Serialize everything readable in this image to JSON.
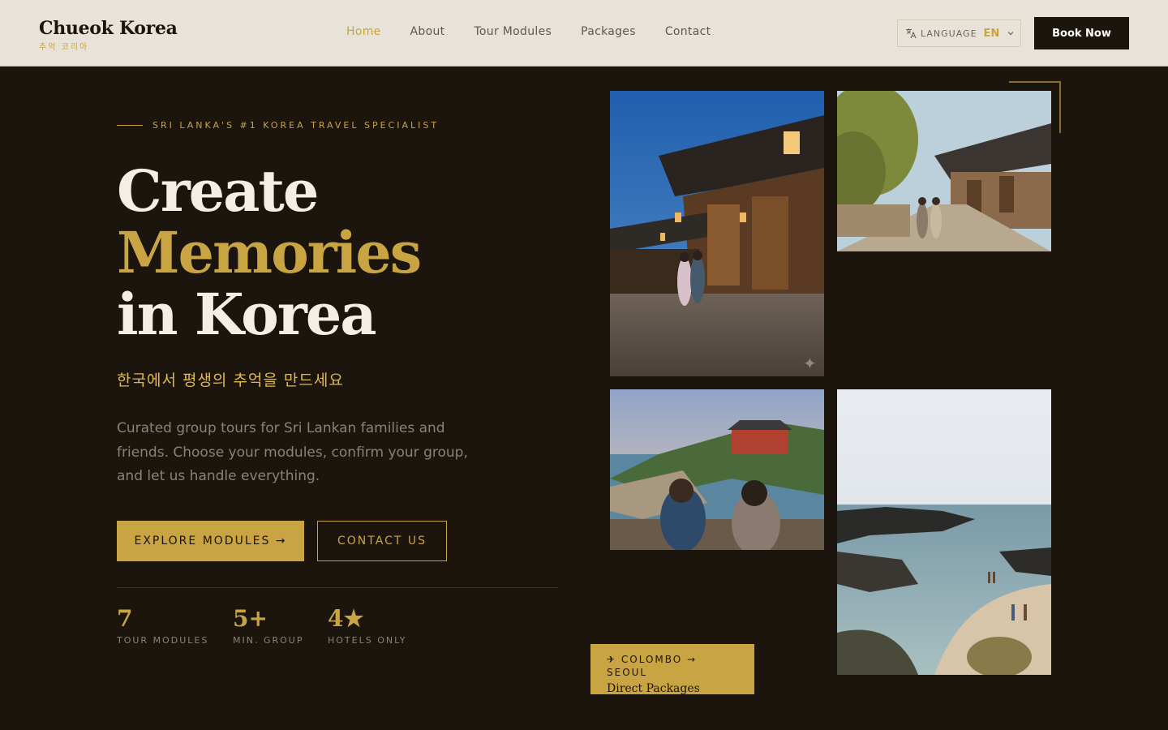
{
  "header": {
    "logo_main": "Chueok Korea",
    "logo_sub": "추억 코리아",
    "nav": [
      {
        "label": "Home",
        "active": true
      },
      {
        "label": "About",
        "active": false
      },
      {
        "label": "Tour Modules",
        "active": false
      },
      {
        "label": "Packages",
        "active": false
      },
      {
        "label": "Contact",
        "active": false
      }
    ],
    "language_label": "LANGUAGE",
    "language_code": "EN",
    "book_label": "Book Now"
  },
  "hero": {
    "eyebrow": "SRI LANKA'S #1 KOREA TRAVEL SPECIALIST",
    "headline_line1": "Create",
    "headline_line2": "Memories",
    "headline_line3": "in Korea",
    "korean_tagline": "한국에서 평생의 추억을 만드세요",
    "description": "Curated group tours for Sri Lankan families and friends. Choose your modules, confirm your group, and let us handle everything.",
    "primary_cta": "EXPLORE MODULES →",
    "secondary_cta": "CONTACT US",
    "stats": [
      {
        "value": "7",
        "label": "TOUR MODULES"
      },
      {
        "value": "5+",
        "label": "MIN. GROUP"
      },
      {
        "value": "4★",
        "label": "HOTELS ONLY"
      }
    ]
  },
  "route_card": {
    "title": "✈ COLOMBO → SEOUL",
    "subtitle": "Direct Packages"
  },
  "colors": {
    "background": "#1c150d",
    "header_bg": "#e8e3d9",
    "gold": "#c9a443",
    "cream": "#f4efe4",
    "muted_text": "#8b8273"
  }
}
